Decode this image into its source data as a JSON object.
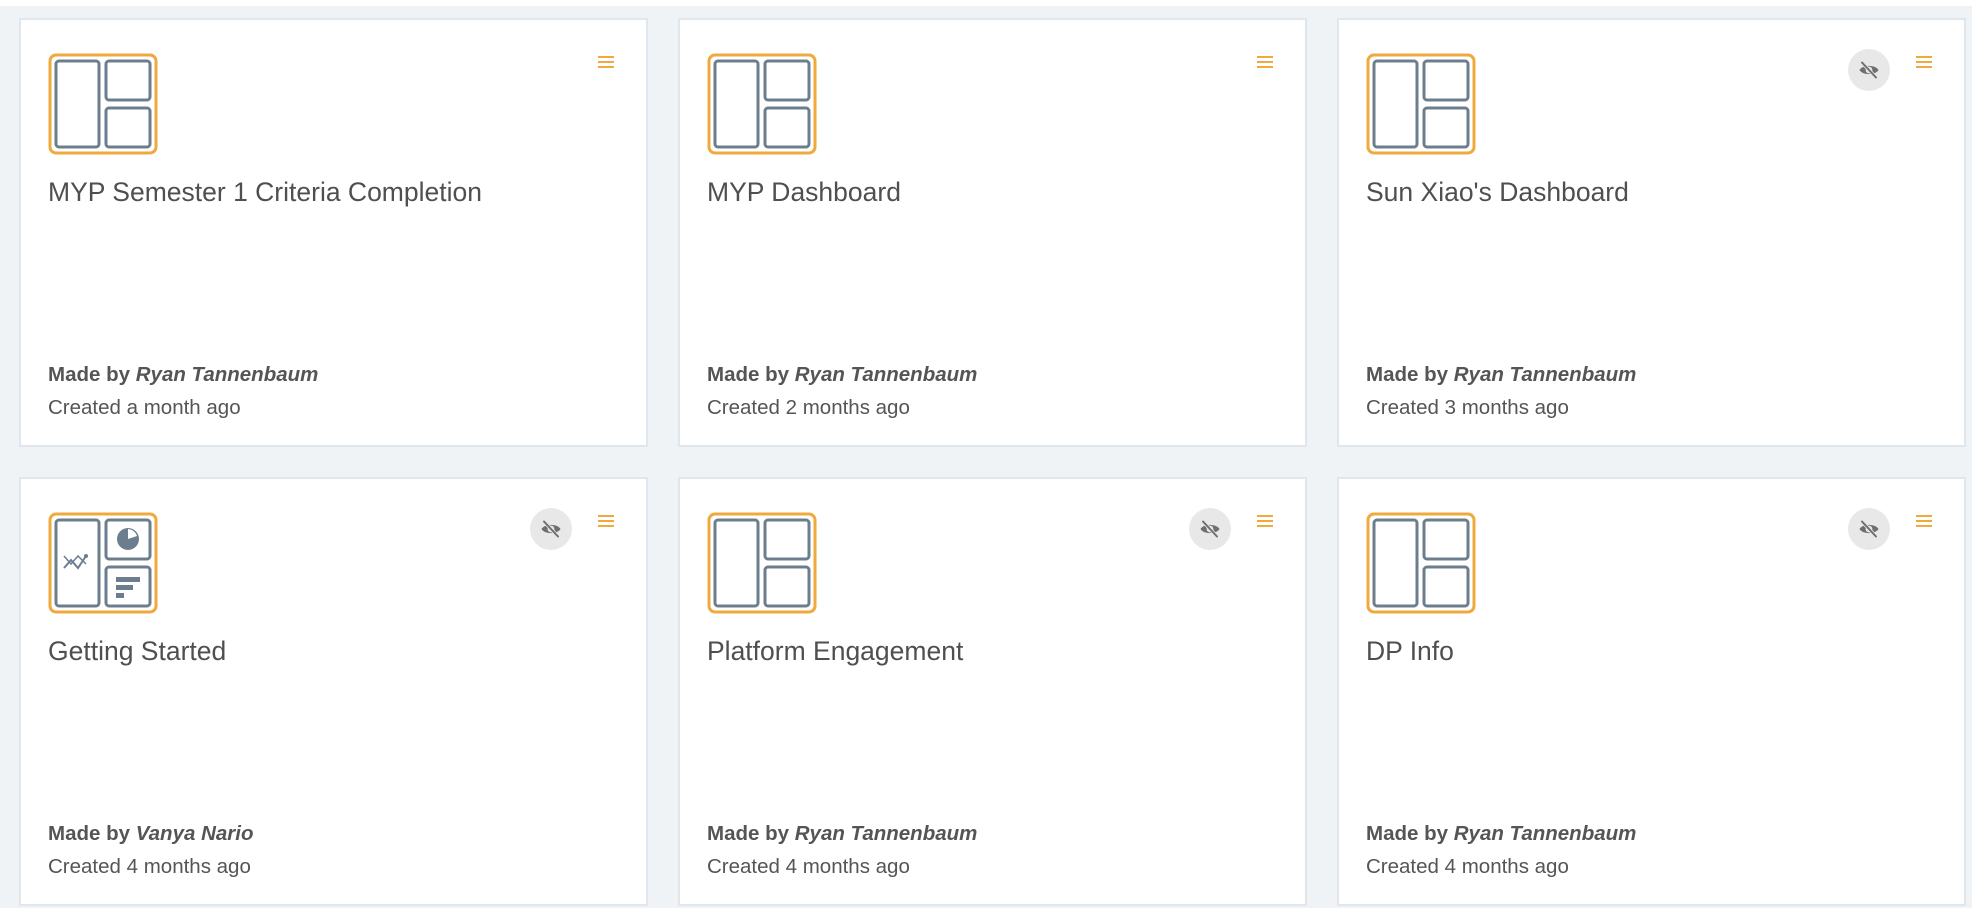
{
  "app": {
    "accent_color": "#f0a93c",
    "icon_color": "#6c7e8e"
  },
  "dashboards": [
    {
      "title": "MYP Semester 1 Criteria Completion",
      "made_by_label": "Made by",
      "author": "Ryan Tannenbaum",
      "created": "Created a month ago",
      "hidden": false,
      "thumbnail": "layout-panels-icon"
    },
    {
      "title": "MYP Dashboard",
      "made_by_label": "Made by",
      "author": "Ryan Tannenbaum",
      "created": "Created 2 months ago",
      "hidden": false,
      "thumbnail": "layout-panels-icon"
    },
    {
      "title": "Sun Xiao's Dashboard",
      "made_by_label": "Made by",
      "author": "Ryan Tannenbaum",
      "created": "Created 3 months ago",
      "hidden": true,
      "thumbnail": "layout-panels-icon"
    },
    {
      "title": "Getting Started",
      "made_by_label": "Made by",
      "author": "Vanya Nario",
      "created": "Created 4 months ago",
      "hidden": true,
      "thumbnail": "chart-layout-icon"
    },
    {
      "title": "Platform Engagement",
      "made_by_label": "Made by",
      "author": "Ryan Tannenbaum",
      "created": "Created 4 months ago",
      "hidden": true,
      "thumbnail": "layout-panels-icon"
    },
    {
      "title": "DP Info",
      "made_by_label": "Made by",
      "author": "Ryan Tannenbaum",
      "created": "Created 4 months ago",
      "hidden": true,
      "thumbnail": "layout-panels-icon"
    }
  ]
}
